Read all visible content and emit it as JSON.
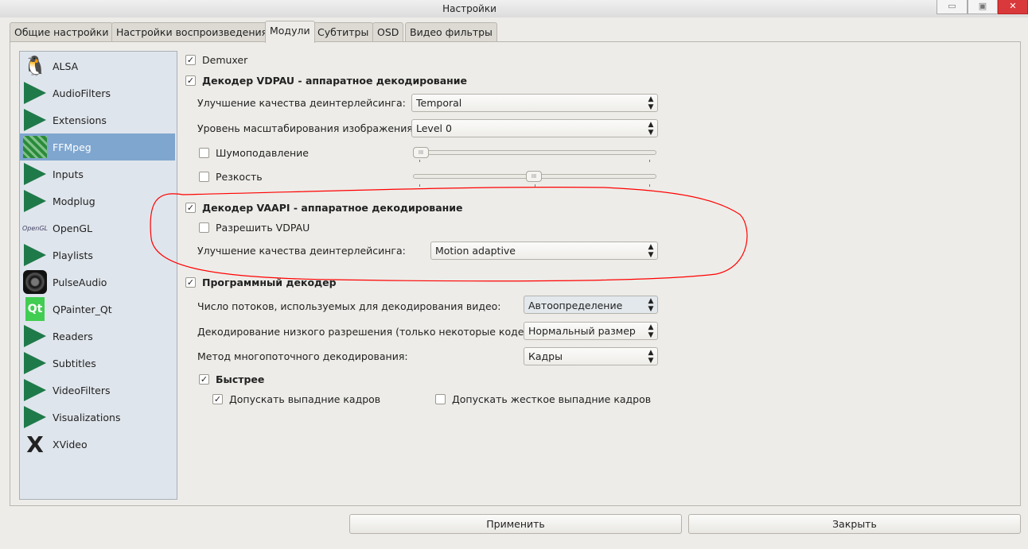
{
  "window": {
    "title": "Настройки"
  },
  "tabs": [
    "Общие настройки",
    "Настройки воспроизведения",
    "Модули",
    "Субтитры",
    "OSD",
    "Видео фильтры"
  ],
  "modules": [
    {
      "label": "ALSA",
      "icon": "alsa-icon"
    },
    {
      "label": "AudioFilters",
      "icon": "plugin-icon"
    },
    {
      "label": "Extensions",
      "icon": "plugin-icon"
    },
    {
      "label": "FFMpeg",
      "icon": "ffmpeg-icon",
      "selected": true
    },
    {
      "label": "Inputs",
      "icon": "plugin-icon"
    },
    {
      "label": "Modplug",
      "icon": "plugin-icon"
    },
    {
      "label": "OpenGL",
      "icon": "opengl-icon"
    },
    {
      "label": "Playlists",
      "icon": "plugin-icon"
    },
    {
      "label": "PulseAudio",
      "icon": "pulseaudio-icon"
    },
    {
      "label": "QPainter_Qt",
      "icon": "qt-icon"
    },
    {
      "label": "Readers",
      "icon": "plugin-icon"
    },
    {
      "label": "Subtitles",
      "icon": "plugin-icon"
    },
    {
      "label": "VideoFilters",
      "icon": "plugin-icon"
    },
    {
      "label": "Visualizations",
      "icon": "plugin-icon"
    },
    {
      "label": "XVideo",
      "icon": "x-icon"
    }
  ],
  "settings": {
    "demuxer": {
      "label": "Demuxer",
      "checked": true
    },
    "vdpau": {
      "label": "Декодер VDPAU - аппаратное декодирование",
      "checked": true,
      "deint_label": "Улучшение качества деинтерлейсинга:",
      "deint_value": "Temporal",
      "scale_label": "Уровень масштабирования изображения:",
      "scale_value": "Level 0",
      "noise_label": "Шумоподавление",
      "noise_checked": false,
      "noise_level": 0,
      "sharp_label": "Резкость",
      "sharp_checked": false,
      "sharp_level": 0.5
    },
    "vaapi": {
      "label": "Декодер VAAPI - аппаратное декодирование",
      "checked": true,
      "allow_vdpau_label": "Разрешить VDPAU",
      "allow_vdpau_checked": false,
      "deint_label": "Улучшение качества деинтерлейсинга:",
      "deint_value": "Motion adaptive"
    },
    "sw": {
      "label": "Программный декодер",
      "checked": true,
      "threads_label": "Число потоков, используемых для декодирования видео:",
      "threads_value": "Автоопределение",
      "lowres_label": "Декодирование низкого разрешения (только некоторые кодеки):",
      "lowres_value": "Нормальный размер",
      "mt_label": "Метод многопоточного декодирования:",
      "mt_value": "Кадры",
      "fast_label": "Быстрее",
      "fast_checked": true,
      "skip_label": "Допускать выпадние кадров",
      "skip_checked": true,
      "hardskip_label": "Допускать жесткое выпадние кадров",
      "hardskip_checked": false
    }
  },
  "buttons": {
    "apply": "Применить",
    "close": "Закрыть"
  },
  "colors": {
    "selection": "#7fa6cf",
    "annotation": "#ff0000",
    "close_button": "#d9393b"
  }
}
